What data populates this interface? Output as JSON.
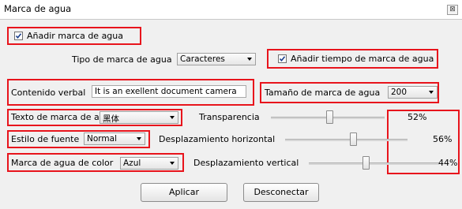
{
  "window": {
    "title": "Marca de agua",
    "close_glyph": "⊠"
  },
  "add_watermark": {
    "label": "Añadir marca de agua",
    "checked": true
  },
  "watermark_type": {
    "label": "Tipo de marca de agua",
    "value": "Caracteres"
  },
  "add_time_watermark": {
    "label": "Añadir tiempo de marca de agua",
    "checked": true
  },
  "verbal_content": {
    "label": "Contenido verbal",
    "value": "It is an exellent document camera"
  },
  "watermark_size": {
    "label": "Tamaño de marca de agua",
    "value": "200"
  },
  "watermark_text": {
    "label": "Texto de marca de agua",
    "value": "黑体"
  },
  "font_style": {
    "label": "Estilo de fuente",
    "value": "Normal"
  },
  "watermark_color": {
    "label": "Marca de agua de color",
    "value": "Azul"
  },
  "transparency": {
    "label": "Transparencia",
    "value": 52,
    "display": "52%"
  },
  "horizontal_offset": {
    "label": "Desplazamiento horizontal",
    "value": 56,
    "display": "56%"
  },
  "vertical_offset": {
    "label": "Desplazamiento vertical",
    "value": 44,
    "display": "44%"
  },
  "buttons": {
    "apply": "Aplicar",
    "disconnect": "Desconectar"
  },
  "colors": {
    "highlight": "#e8141c",
    "panel": "#f0f0f0"
  }
}
